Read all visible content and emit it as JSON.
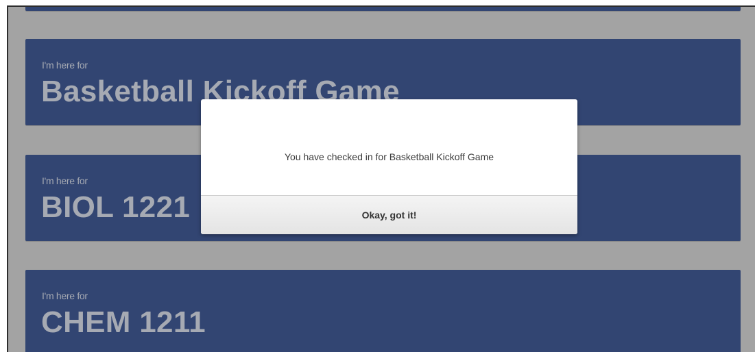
{
  "cards": [
    {
      "subtitle": "I'm here for",
      "title": "Basketball Kickoff Game"
    },
    {
      "subtitle": "I'm here for",
      "title": "BIOL 1221"
    },
    {
      "subtitle": "I'm here for",
      "title": "CHEM 1211"
    }
  ],
  "modal": {
    "message": "You have checked in for Basketball Kickoff Game",
    "button_label": "Okay, got it!"
  },
  "colors": {
    "card_background": "#324572",
    "card_text": "#a6aab3",
    "overlay": "#a3a3a3",
    "modal_background": "#ffffff"
  }
}
